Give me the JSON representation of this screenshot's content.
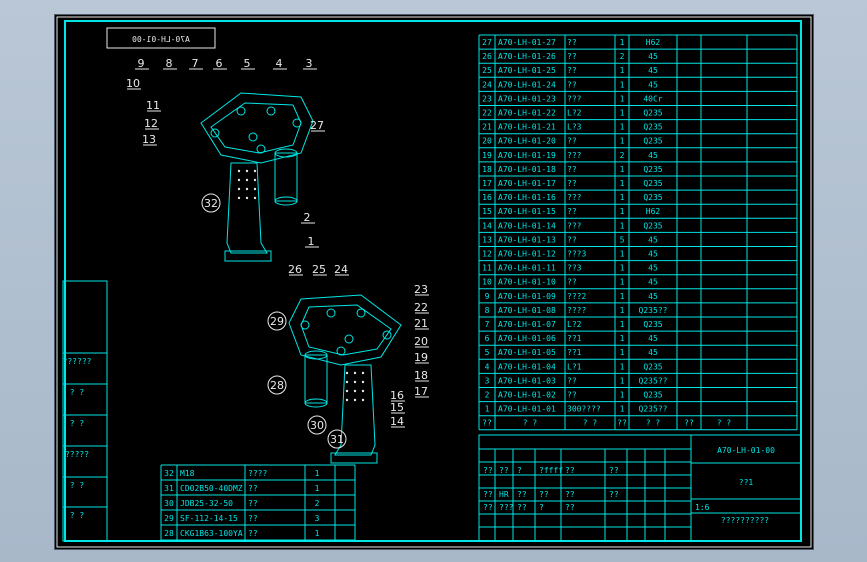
{
  "drawing_code": "A70-LH-01-00",
  "parts_top": [
    {
      "no": "27",
      "code": "A70-LH-01-27",
      "name": "??",
      "qty": "1",
      "mat": "H62"
    },
    {
      "no": "26",
      "code": "A70-LH-01-26",
      "name": "??",
      "qty": "2",
      "mat": "45"
    },
    {
      "no": "25",
      "code": "A70-LH-01-25",
      "name": "??",
      "qty": "1",
      "mat": "45"
    },
    {
      "no": "24",
      "code": "A70-LH-01-24",
      "name": "??",
      "qty": "1",
      "mat": "45"
    },
    {
      "no": "23",
      "code": "A70-LH-01-23",
      "name": "???",
      "qty": "1",
      "mat": "40Cr"
    },
    {
      "no": "22",
      "code": "A70-LH-01-22",
      "name": "L?2",
      "qty": "1",
      "mat": "Q235"
    },
    {
      "no": "21",
      "code": "A70-LH-01-21",
      "name": "L?3",
      "qty": "1",
      "mat": "Q235"
    },
    {
      "no": "20",
      "code": "A70-LH-01-20",
      "name": "??",
      "qty": "1",
      "mat": "Q235"
    },
    {
      "no": "19",
      "code": "A70-LH-01-19",
      "name": "???",
      "qty": "2",
      "mat": "45"
    },
    {
      "no": "18",
      "code": "A70-LH-01-18",
      "name": "??",
      "qty": "1",
      "mat": "Q235"
    },
    {
      "no": "17",
      "code": "A70-LH-01-17",
      "name": "??",
      "qty": "1",
      "mat": "Q235"
    },
    {
      "no": "16",
      "code": "A70-LH-01-16",
      "name": "???",
      "qty": "1",
      "mat": "Q235"
    },
    {
      "no": "15",
      "code": "A70-LH-01-15",
      "name": "??",
      "qty": "1",
      "mat": "H62"
    },
    {
      "no": "14",
      "code": "A70-LH-01-14",
      "name": "???",
      "qty": "1",
      "mat": "Q235"
    },
    {
      "no": "13",
      "code": "A70-LH-01-13",
      "name": "??",
      "qty": "5",
      "mat": "45"
    },
    {
      "no": "12",
      "code": "A70-LH-01-12",
      "name": "???3",
      "qty": "1",
      "mat": "45"
    },
    {
      "no": "11",
      "code": "A70-LH-01-11",
      "name": "??3",
      "qty": "1",
      "mat": "45"
    },
    {
      "no": "10",
      "code": "A70-LH-01-10",
      "name": "??",
      "qty": "1",
      "mat": "45"
    },
    {
      "no": "9",
      "code": "A70-LH-01-09",
      "name": "???2",
      "qty": "1",
      "mat": "45"
    },
    {
      "no": "8",
      "code": "A70-LH-01-08",
      "name": "????",
      "qty": "1",
      "mat": "Q235??"
    },
    {
      "no": "7",
      "code": "A70-LH-01-07",
      "name": "L?2",
      "qty": "1",
      "mat": "Q235"
    },
    {
      "no": "6",
      "code": "A70-LH-01-06",
      "name": "??1",
      "qty": "1",
      "mat": "45"
    },
    {
      "no": "5",
      "code": "A70-LH-01-05",
      "name": "??1",
      "qty": "1",
      "mat": "45"
    },
    {
      "no": "4",
      "code": "A70-LH-01-04",
      "name": "L?1",
      "qty": "1",
      "mat": "Q235"
    },
    {
      "no": "3",
      "code": "A70-LH-01-03",
      "name": "??",
      "qty": "1",
      "mat": "Q235??"
    },
    {
      "no": "2",
      "code": "A70-LH-01-02",
      "name": "??",
      "qty": "1",
      "mat": "Q235"
    },
    {
      "no": "1",
      "code": "A70-LH-01-01",
      "name": "300????",
      "qty": "1",
      "mat": "Q235??"
    }
  ],
  "parts_header": [
    "??",
    "?  ?",
    "?  ?",
    "??",
    "?  ?",
    "??",
    "?  ?"
  ],
  "parts_bottom": [
    {
      "no": "32",
      "code": "M18",
      "name": "????",
      "qty": "1"
    },
    {
      "no": "31",
      "code": "CD02B50-40DMZ",
      "name": "??",
      "qty": "1"
    },
    {
      "no": "30",
      "code": "JDB25-32-50",
      "name": "??",
      "qty": "2"
    },
    {
      "no": "29",
      "code": "SF-112-14-15",
      "name": "??",
      "qty": "3"
    },
    {
      "no": "28",
      "code": "CKG1B63-100YA",
      "name": "??",
      "qty": "1"
    }
  ],
  "side_boxes": [
    "??????",
    "?  ?",
    "?  ?",
    "?????",
    "?  ?",
    "?  ?"
  ],
  "title_block": {
    "code": "A70-LH-01-00",
    "name": "??1",
    "company": "??????????",
    "row1": [
      "??",
      "??",
      "?",
      "?ffff",
      "??",
      "??"
    ],
    "row2": [
      "??",
      "HR",
      "??",
      "??",
      "??",
      "??"
    ],
    "row3": [
      "??",
      "???",
      "??",
      "?",
      "??"
    ],
    "scale_note": "1:6"
  },
  "callouts": [
    "1",
    "2",
    "3",
    "4",
    "5",
    "6",
    "7",
    "8",
    "9",
    "10",
    "11",
    "12",
    "13",
    "14",
    "15",
    "16",
    "17",
    "18",
    "19",
    "20",
    "21",
    "22",
    "23",
    "24",
    "25",
    "26",
    "27",
    "28",
    "29",
    "30",
    "31",
    "32"
  ]
}
